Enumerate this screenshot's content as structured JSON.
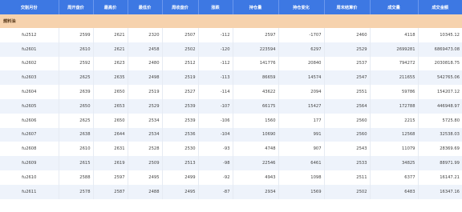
{
  "headers": [
    "交割月份",
    "周开盘价",
    "最高价",
    "最低价",
    "周收盘价",
    "涨跌",
    "持仓量",
    "持仓变化",
    "周末结算价",
    "成交量",
    "成交金额"
  ],
  "group_label": "燃料油",
  "rows": [
    [
      "fu2512",
      "2599",
      "2621",
      "2320",
      "2507",
      "-112",
      "2597",
      "-1707",
      "2460",
      "4118",
      "10345.12"
    ],
    [
      "fu2601",
      "2610",
      "2621",
      "2458",
      "2502",
      "-120",
      "223594",
      "6297",
      "2529",
      "2699281",
      "6869473.08"
    ],
    [
      "fu2602",
      "2592",
      "2623",
      "2480",
      "2512",
      "-112",
      "141776",
      "20840",
      "2537",
      "794272",
      "2030818.75"
    ],
    [
      "fu2603",
      "2625",
      "2635",
      "2498",
      "2519",
      "-113",
      "86659",
      "14574",
      "2547",
      "211655",
      "542765.06"
    ],
    [
      "fu2604",
      "2639",
      "2650",
      "2519",
      "2527",
      "-114",
      "43622",
      "2094",
      "2551",
      "59786",
      "154207.12"
    ],
    [
      "fu2605",
      "2650",
      "2653",
      "2529",
      "2539",
      "-107",
      "66175",
      "15427",
      "2564",
      "172788",
      "446948.97"
    ],
    [
      "fu2606",
      "2625",
      "2650",
      "2534",
      "2539",
      "-106",
      "1560",
      "177",
      "2560",
      "2215",
      "5725.80"
    ],
    [
      "fu2607",
      "2638",
      "2644",
      "2534",
      "2536",
      "-104",
      "10690",
      "991",
      "2560",
      "12568",
      "32538.03"
    ],
    [
      "fu2608",
      "2610",
      "2631",
      "2528",
      "2530",
      "-93",
      "4748",
      "907",
      "2543",
      "11079",
      "28369.69"
    ],
    [
      "fu2609",
      "2615",
      "2619",
      "2509",
      "2513",
      "-98",
      "22546",
      "6461",
      "2533",
      "34825",
      "88971.99"
    ],
    [
      "fu2610",
      "2588",
      "2597",
      "2495",
      "2499",
      "-92",
      "4943",
      "1098",
      "2511",
      "6377",
      "16147.21"
    ],
    [
      "fu2611",
      "2578",
      "2587",
      "2488",
      "2495",
      "-87",
      "2934",
      "1569",
      "2502",
      "6483",
      "16347.16"
    ]
  ]
}
